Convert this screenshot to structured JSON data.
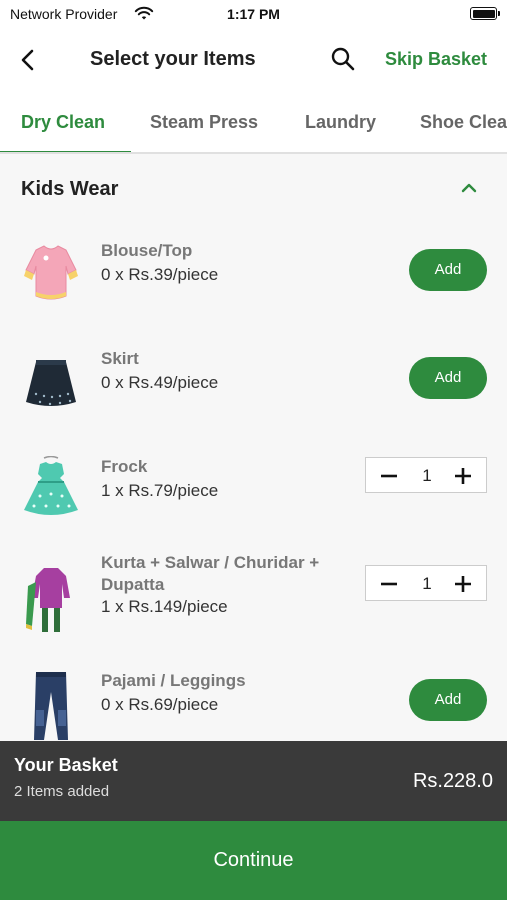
{
  "status": {
    "carrier": "Network Provider",
    "time": "1:17 PM",
    "wifi_icon": "wifi-icon",
    "battery_icon": "battery-icon"
  },
  "header": {
    "back_icon": "chevron-left-icon",
    "title": "Select your Items",
    "search_icon": "search-icon",
    "skip_label": "Skip Basket"
  },
  "tabs": [
    {
      "label": "Dry Clean",
      "active": true
    },
    {
      "label": "Steam Press",
      "active": false
    },
    {
      "label": "Laundry",
      "active": false
    },
    {
      "label": "Shoe Clea",
      "active": false
    }
  ],
  "section": {
    "title": "Kids Wear",
    "toggle_icon": "chevron-up-icon"
  },
  "items": [
    {
      "name": "Blouse/Top",
      "price": "0 x Rs.39/piece",
      "action": "Add",
      "image_icon": "blouse-icon"
    },
    {
      "name": "Skirt",
      "price": "0 x Rs.49/piece",
      "action": "Add",
      "image_icon": "skirt-icon"
    },
    {
      "name": "Frock",
      "price": "1 x Rs.79/piece",
      "quantity": "1",
      "image_icon": "frock-icon"
    },
    {
      "name": "Kurta + Salwar / Churidar + Dupatta",
      "price": "1 x Rs.149/piece",
      "quantity": "1",
      "image_icon": "kurta-icon"
    },
    {
      "name": "Pajami / Leggings",
      "price": "0 x Rs.69/piece",
      "action": "Add",
      "image_icon": "leggings-icon"
    }
  ],
  "basket": {
    "title": "Your Basket",
    "count": "2 Items added",
    "total": "Rs.228.0"
  },
  "continue_label": "Continue",
  "colors": {
    "accent": "#2e8b3e",
    "basket_bg": "#3a3a3a"
  }
}
